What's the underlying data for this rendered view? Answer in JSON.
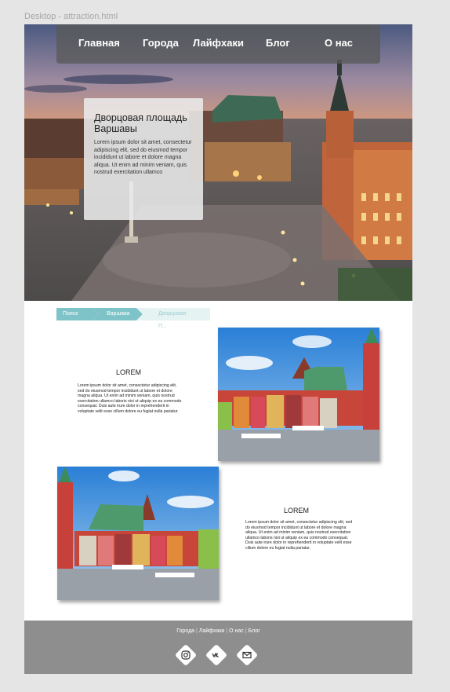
{
  "window": {
    "title": "Desktop - attraction.html"
  },
  "nav": {
    "items": [
      "Главная",
      "Города",
      "Лайфхаки",
      "Блог",
      "О нас"
    ]
  },
  "hero": {
    "title": "Дворцовая площадь Варшавы",
    "text": "Lorem ipsum dolor sit amet, consectetur adipiscing elit, sed do eiusmod tempor incididunt ut labore et dolore magna aliqua. Ut enim ad minim veniam, quis nostrud exercitation ullamco"
  },
  "breadcrumb": {
    "items": [
      "Поиск",
      "Варшава",
      "Дворцовая П..."
    ],
    "colors": {
      "active": "#7ec3c7",
      "inactive": "#e6f3f3"
    }
  },
  "section1": {
    "title": "LOREM",
    "text": "Lorem ipsum dolor sit amet, consectetur adipiscing elit, sed do eiusmod tempor incididunt ut labore et dolore magna aliqua. Ut enim ad minim veniam, quis nostrud exercitation ullamco laboris nisi ut aliquip ex ea commodo consequat. Duis aute irure dolor in reprehenderit in voluptate velit esse cillum dolore eu fugiat nulla pariatur."
  },
  "section2": {
    "title": "LOREM",
    "text": "Lorem ipsum dolor sit amet, consectetur adipiscing elit, sed do eiusmod tempor incididunt ut labore et dolore magna aliqua. Ut enim ad minim veniam, quis nostrud exercitation ullamco laboris nisi ut aliquip ex ea commodo consequat. Duis aute irure dolor in reprehenderit in voluptate velit esse cillum dolore eu fugiat nulla pariatur."
  },
  "footer": {
    "links": [
      "Города",
      "Лайфхаки",
      "О нас",
      "Блог"
    ],
    "social": [
      "instagram-icon",
      "vk-icon",
      "mail-icon"
    ],
    "background": "#8e8e8e"
  }
}
